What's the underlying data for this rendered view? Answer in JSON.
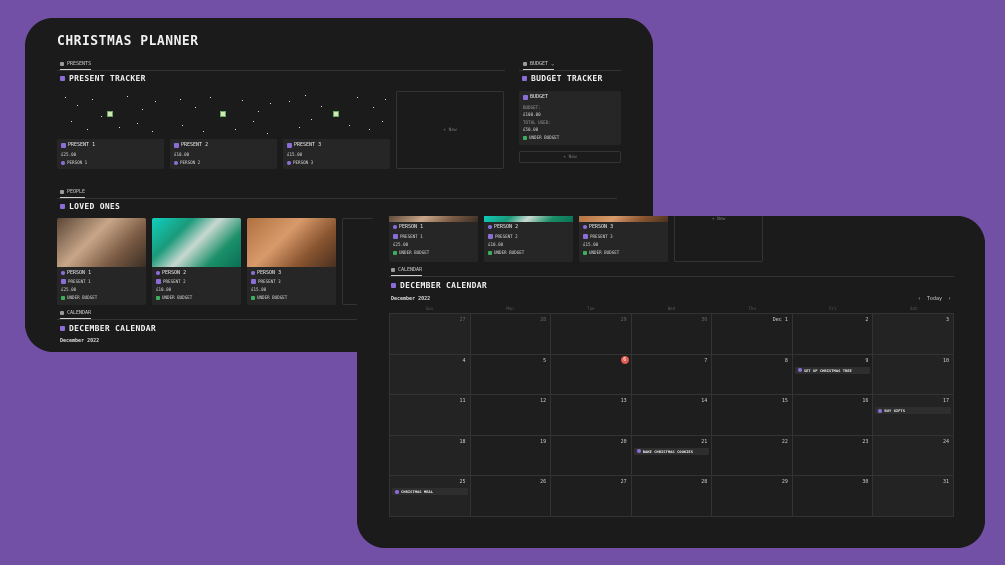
{
  "title": "CHRISTMAS PLANNER",
  "colors": {
    "background": "#7150a6",
    "accent": "#8c6cd6",
    "today": "#e05a4f",
    "under_budget": "#3fae5a"
  },
  "views": {
    "presents": "PRESENTS",
    "budget": "BUDGET",
    "people": "PEOPLE",
    "calendar": "CALENDAR"
  },
  "sections": {
    "present_tracker": "PRESENT TRACKER",
    "budget_tracker": "BUDGET TRACKER",
    "loved_ones": "LOVED ONES",
    "december_calendar": "DECEMBER CALENDAR"
  },
  "new_label": "+ New",
  "presents": [
    {
      "name": "PRESENT 1",
      "price": "£25.00",
      "person": "PERSON 1"
    },
    {
      "name": "PRESENT 2",
      "price": "£10.00",
      "person": "PERSON 2"
    },
    {
      "name": "PRESENT 3",
      "price": "£15.00",
      "person": "PERSON 3"
    }
  ],
  "budget": {
    "name": "BUDGET",
    "budget_label": "BUDGET:",
    "budget_value": "£100.00",
    "used_label": "TOTAL USED:",
    "used_value": "£50.00",
    "status": "UNDER BUDGET"
  },
  "people": [
    {
      "name": "PERSON 1",
      "present": "PRESENT 1",
      "amount": "£25.00",
      "status": "UNDER BUDGET"
    },
    {
      "name": "PERSON 2",
      "present": "PRESENT 2",
      "amount": "£10.00",
      "status": "UNDER BUDGET"
    },
    {
      "name": "PERSON 3",
      "present": "PRESENT 3",
      "amount": "£15.00",
      "status": "UNDER BUDGET"
    }
  ],
  "calendar": {
    "month": "December 2022",
    "today_label": "Today",
    "weekdays": [
      "Sun",
      "Mon",
      "Tue",
      "Wed",
      "Thu",
      "Fri",
      "Sat"
    ],
    "weeks": [
      [
        "27",
        "28",
        "29",
        "30",
        "Dec 1",
        "2",
        "3"
      ],
      [
        "4",
        "5",
        "6",
        "7",
        "8",
        "9",
        "10"
      ],
      [
        "11",
        "12",
        "13",
        "14",
        "15",
        "16",
        "17"
      ],
      [
        "18",
        "19",
        "20",
        "21",
        "22",
        "23",
        "24"
      ],
      [
        "25",
        "26",
        "27",
        "28",
        "29",
        "30",
        "31"
      ]
    ],
    "today": "6",
    "events": [
      {
        "day": "9",
        "label": "SET UP CHRISTMAS TREE"
      },
      {
        "day": "17",
        "label": "BUY GIFTS"
      },
      {
        "day": "21",
        "label": "BAKE CHRISTMAS COOKIES"
      },
      {
        "day": "25",
        "label": "CHRISTMAS MEAL"
      }
    ]
  }
}
